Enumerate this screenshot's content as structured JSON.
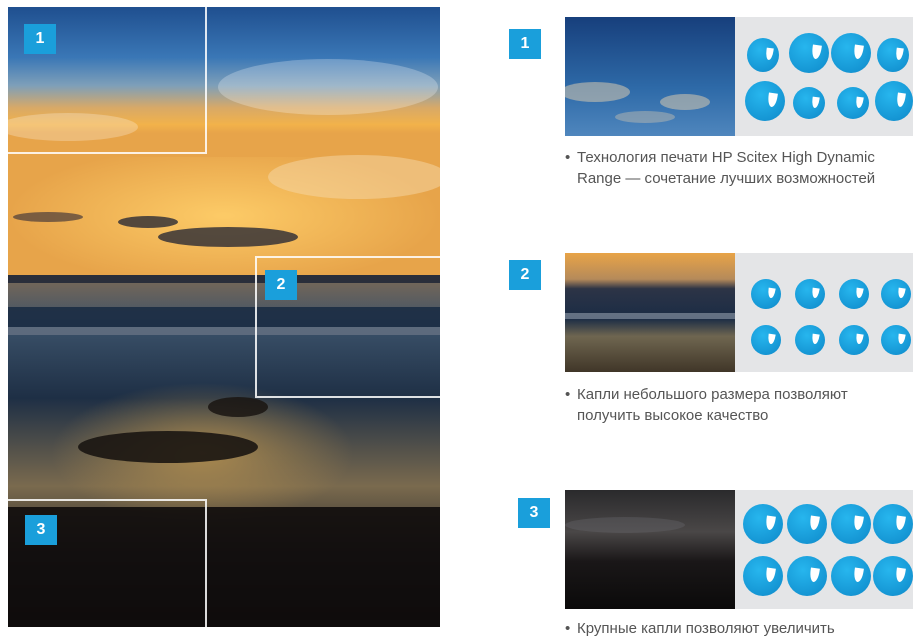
{
  "badges": [
    "1",
    "2",
    "3"
  ],
  "captions": [
    {
      "lines": [
        "Технология печати HP Scitex High Dynamic",
        "Range — сочетание лучших возможностей"
      ]
    },
    {
      "lines": [
        "Капли небольшого размера позволяют",
        "получить высокое качество"
      ]
    },
    {
      "lines": [
        "Крупные капли позволяют увеличить"
      ]
    }
  ],
  "bullet": "•",
  "colors": {
    "badge": "#1a9fdb",
    "drop": "#1596d4",
    "panel": "#e4e5e7",
    "caption": "#555555"
  },
  "icons": [
    "droplet-icon"
  ]
}
